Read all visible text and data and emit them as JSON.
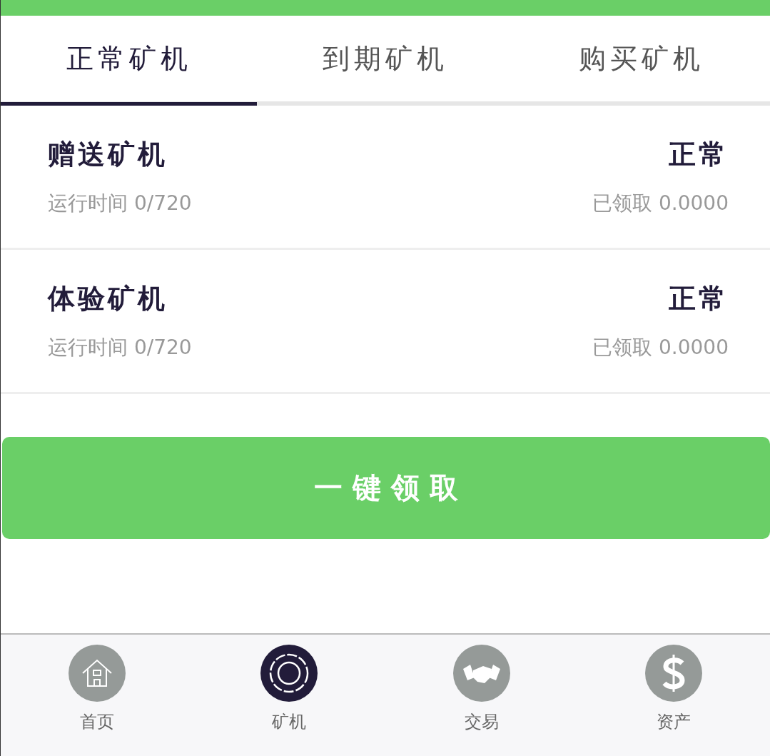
{
  "tabs": [
    {
      "label": "正常矿机",
      "selected": true
    },
    {
      "label": "到期矿机",
      "selected": false
    },
    {
      "label": "购买矿机",
      "selected": false
    }
  ],
  "machines": [
    {
      "name": "赠送矿机",
      "status": "正常",
      "runtime": "运行时间 0/720",
      "claimed": "已领取 0.0000"
    },
    {
      "name": "体验矿机",
      "status": "正常",
      "runtime": "运行时间 0/720",
      "claimed": "已领取 0.0000"
    }
  ],
  "claim_button": "一 键 领 取",
  "nav": [
    {
      "label": "首页",
      "kind": "home",
      "selected": false
    },
    {
      "label": "矿机",
      "kind": "miner",
      "selected": true
    },
    {
      "label": "交易",
      "kind": "trade",
      "selected": false
    },
    {
      "label": "资产",
      "kind": "assets",
      "selected": false
    }
  ]
}
